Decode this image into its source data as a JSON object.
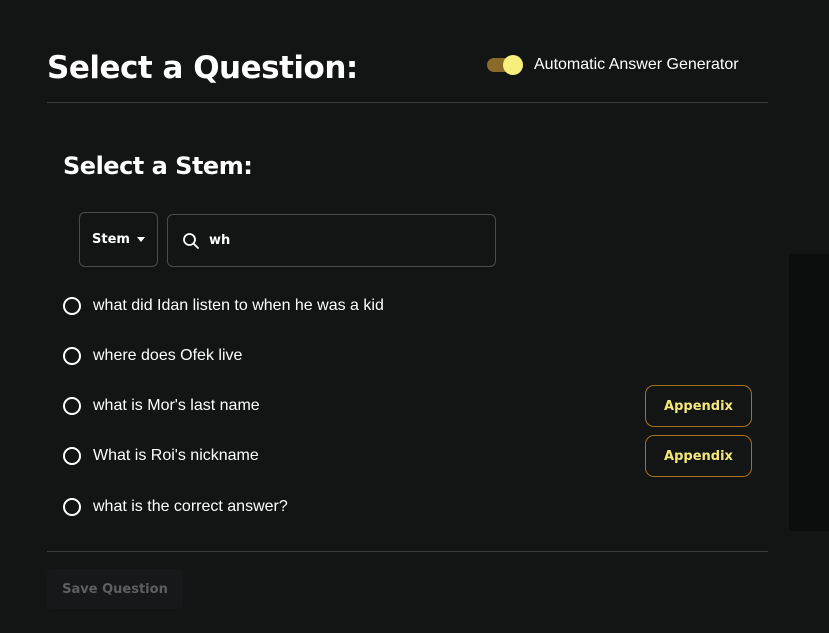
{
  "header": {
    "title": "Select a Question:",
    "toggle": {
      "label": "Automatic Answer Generator",
      "on": true,
      "track_color": "#8a6a2a",
      "knob_color": "#f7ef7b"
    }
  },
  "stem_section": {
    "title": "Select a Stem:",
    "filter_select": {
      "selected": "Stem"
    },
    "search": {
      "value": "wh",
      "placeholder": ""
    }
  },
  "questions": [
    {
      "text": "what did Idan listen to when he was a kid",
      "appendix": null
    },
    {
      "text": "where does Ofek live",
      "appendix": null
    },
    {
      "text": "what is Mor's last name",
      "appendix": "Appendix"
    },
    {
      "text": "What is Roi's nickname",
      "appendix": "Appendix"
    },
    {
      "text": "what is the correct answer?",
      "appendix": null
    }
  ],
  "footer": {
    "save_label": "Save Question",
    "save_enabled": false
  },
  "colors": {
    "background": "#131414",
    "accent": "#f5e87a",
    "appendix_border": "#a7701d",
    "divider": "#3b3c3c"
  }
}
